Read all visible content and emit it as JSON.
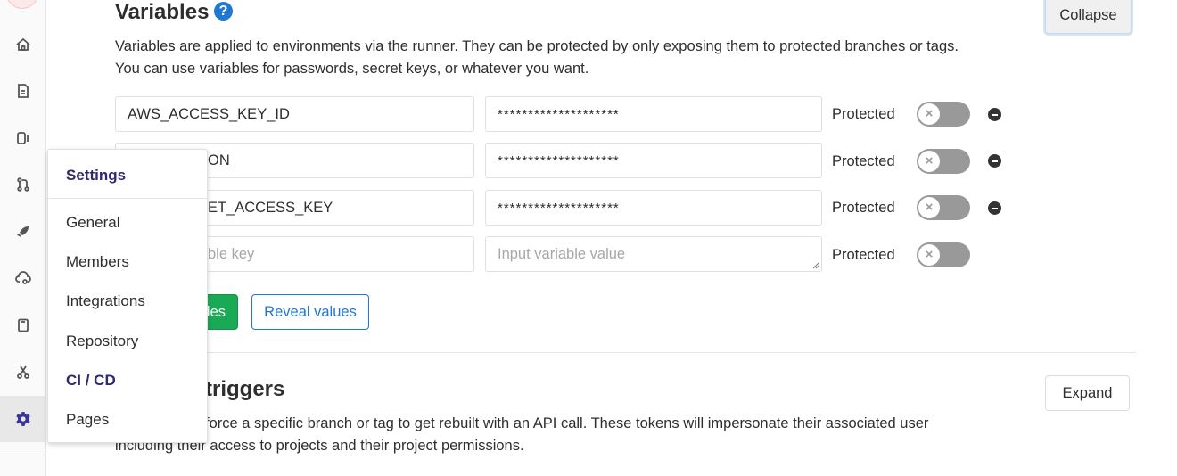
{
  "flyout": {
    "title": "Settings",
    "items": [
      "General",
      "Members",
      "Integrations",
      "Repository",
      "CI / CD",
      "Pages"
    ]
  },
  "rail_icons": [
    "home-icon",
    "file-icon",
    "issues-icon",
    "merge-request-icon",
    "rocket-icon",
    "operations-icon",
    "wiki-icon",
    "snippets-icon",
    "settings-icon"
  ],
  "variables": {
    "title": "Variables",
    "help": "?",
    "description_line1": "Variables are applied to environments via the runner. They can be protected by only exposing them to protected branches or tags.",
    "description_line2": "You can use variables for passwords, secret keys, or whatever you want.",
    "collapse_label": "Collapse",
    "rows": [
      {
        "key": "AWS_ACCESS_KEY_ID",
        "value": "********************",
        "protected_label": "Protected"
      },
      {
        "key": "ON",
        "value": "********************",
        "protected_label": "Protected"
      },
      {
        "key": "ET_ACCESS_KEY",
        "value": "********************",
        "protected_label": "Protected"
      }
    ],
    "new_row": {
      "key_placeholder": "ble key",
      "value_placeholder": "Input variable value",
      "protected_label": "Protected"
    },
    "save_label": "les",
    "reveal_label": "Reveal values"
  },
  "triggers": {
    "title": "triggers",
    "expand_label": "Expand",
    "description_line1": "force a specific branch or tag to get rebuilt with an API call. These tokens will impersonate their associated user",
    "description_line2": "including their access to projects and their project permissions."
  },
  "colors": {
    "primary": "#1f78d1",
    "success": "#1aaa55",
    "flyout_title": "#2f2a6b",
    "toggle_off": "#999999"
  }
}
